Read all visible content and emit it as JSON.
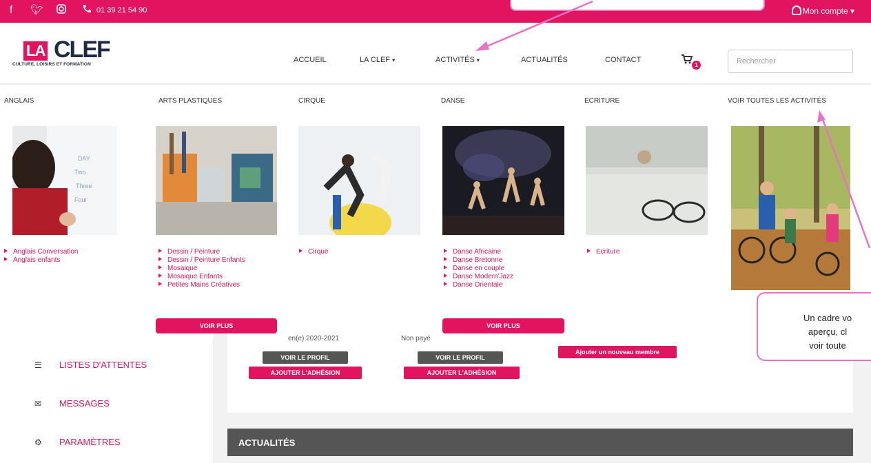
{
  "topbar": {
    "social": [
      "facebook-icon",
      "twitter-icon",
      "instagram-icon"
    ],
    "phone": "01 39 21 54 90",
    "account": "Mon compte",
    "account_caret": "▾"
  },
  "logo": {
    "la": "LA",
    "clef": "CLEF",
    "tagline": "CULTURE, LOISIRS ET FORMATION"
  },
  "nav": {
    "accueil": "ACCUEIL",
    "laclef": "LA CLEF",
    "activites": "ACTIVITÉS",
    "actualites": "ACTUALITÉS",
    "contact": "CONTACT",
    "cart_count": "1",
    "caret": "▾"
  },
  "search": {
    "placeholder": "Rechercher"
  },
  "menu": {
    "columns": [
      {
        "title": "ANGLAIS",
        "items": [
          "Anglais Conversation",
          "Anglais enfants"
        ]
      },
      {
        "title": "ARTS PLASTIQUES",
        "items": [
          "Dessin / Peinture",
          "Dessin / Peinture Enfants",
          "Mosaique",
          "Mosaique Enfants",
          "Petites Mains Créatives"
        ],
        "more": "VOIR PLUS"
      },
      {
        "title": "CIRQUE",
        "items": [
          "Cirque"
        ]
      },
      {
        "title": "DANSE",
        "items": [
          "Danse Africaine",
          "Danse Bretonne",
          "Danse en couple",
          "Danse Modern'Jazz",
          "Danse Orientale"
        ],
        "more": "VOIR PLUS"
      },
      {
        "title": "ECRITURE",
        "items": [
          "Ecriture"
        ]
      },
      {
        "title": "VOIR TOUTES LES ACTIVITÉS",
        "items": []
      }
    ]
  },
  "page": {
    "partial_left": "en(e) 2020-2021",
    "partial_mid": "Non payé",
    "voir_profil": "VOIR LE PROFIL",
    "ajouter_adhesion": "AJOUTER L'ADHÉSION",
    "ajouter_membre": "Ajouter un nouveau membre",
    "sidebar": [
      "LISTES D'ATTENTES",
      "MESSAGES",
      "PARAMÈTRES"
    ],
    "actualites_header": "ACTUALITÉS"
  },
  "callout": {
    "lines": [
      "Un cadre vo",
      "aperçu, cl",
      "voir toute"
    ]
  },
  "colors": {
    "accent": "#e2145f",
    "callout_border": "#e873c4",
    "dark_button": "#555555"
  }
}
